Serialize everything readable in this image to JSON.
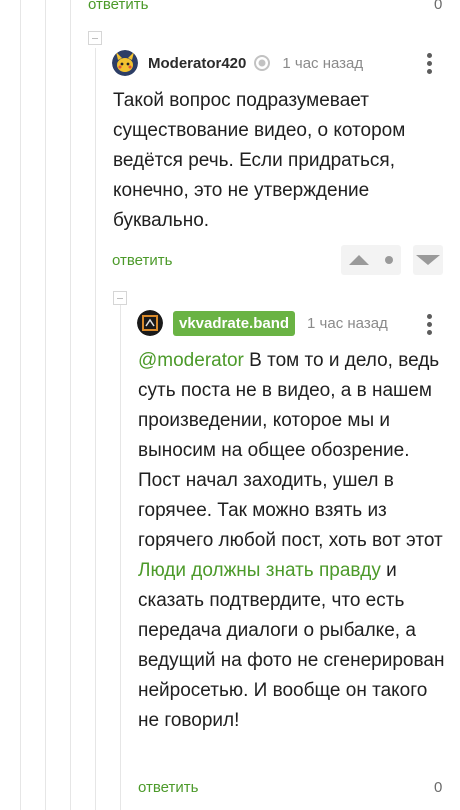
{
  "top_row": {
    "reply_label": "ответить",
    "count": "0"
  },
  "comment1": {
    "username": "Moderator420",
    "time": "1 час назад",
    "avatar_icon": "pikachu-avatar",
    "badge_icon": "moderator-badge-icon",
    "text": "Такой вопрос подразумевает существование видео, о котором ведётся речь. Если придраться, конечно, это не утверждение буквально.",
    "reply_label": "ответить"
  },
  "comment2": {
    "username": "vkvadrate.band",
    "time": "1 час назад",
    "avatar_icon": "vkvadrate-logo-avatar",
    "mention": "@moderator",
    "text_part1": " В том то и дело, ведь суть поста не в видео, а в нашем произведении, которое мы и выносим на общее обозрение. Пост начал заходить, ушел в горячее. Так можно взять из горячего любой пост, хоть вот этот ",
    "link_text": "Люди должны знать правду",
    "text_part2": " и сказать подтвердите, что есть передача диалоги о рыбалке, а ведущий на фото не сгенерирован нейросетью. И вообще он такого не говорил!",
    "reply_label": "ответить",
    "count": "0"
  },
  "colors": {
    "accent": "#4c9a2a",
    "chip": "#6ab344"
  }
}
